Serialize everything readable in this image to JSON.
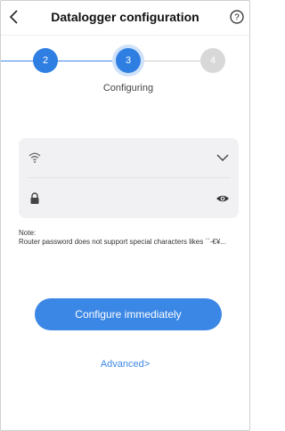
{
  "header": {
    "title": "Datalogger configuration",
    "back_icon": "chevron-left-icon",
    "help_icon": "question-circle-icon"
  },
  "steps": {
    "items": [
      {
        "number": "2",
        "state": "done"
      },
      {
        "number": "3",
        "state": "active"
      },
      {
        "number": "4",
        "state": "pending"
      }
    ],
    "current_label": "Configuring"
  },
  "form": {
    "wifi": {
      "icon": "wifi-icon",
      "value": "",
      "placeholder": "",
      "trailing_icon": "chevron-down-icon"
    },
    "password": {
      "icon": "lock-icon",
      "value": "",
      "placeholder": "",
      "trailing_icon": "eye-icon"
    }
  },
  "note": {
    "heading": "Note:",
    "text": "Router password does not support special characters likes ``-€¥..."
  },
  "actions": {
    "configure_label": "Configure immediately",
    "advanced_label": "Advanced>"
  },
  "colors": {
    "accent": "#3b87e6",
    "pending": "#d8d8d8",
    "field_bg": "#f1f1f3"
  }
}
